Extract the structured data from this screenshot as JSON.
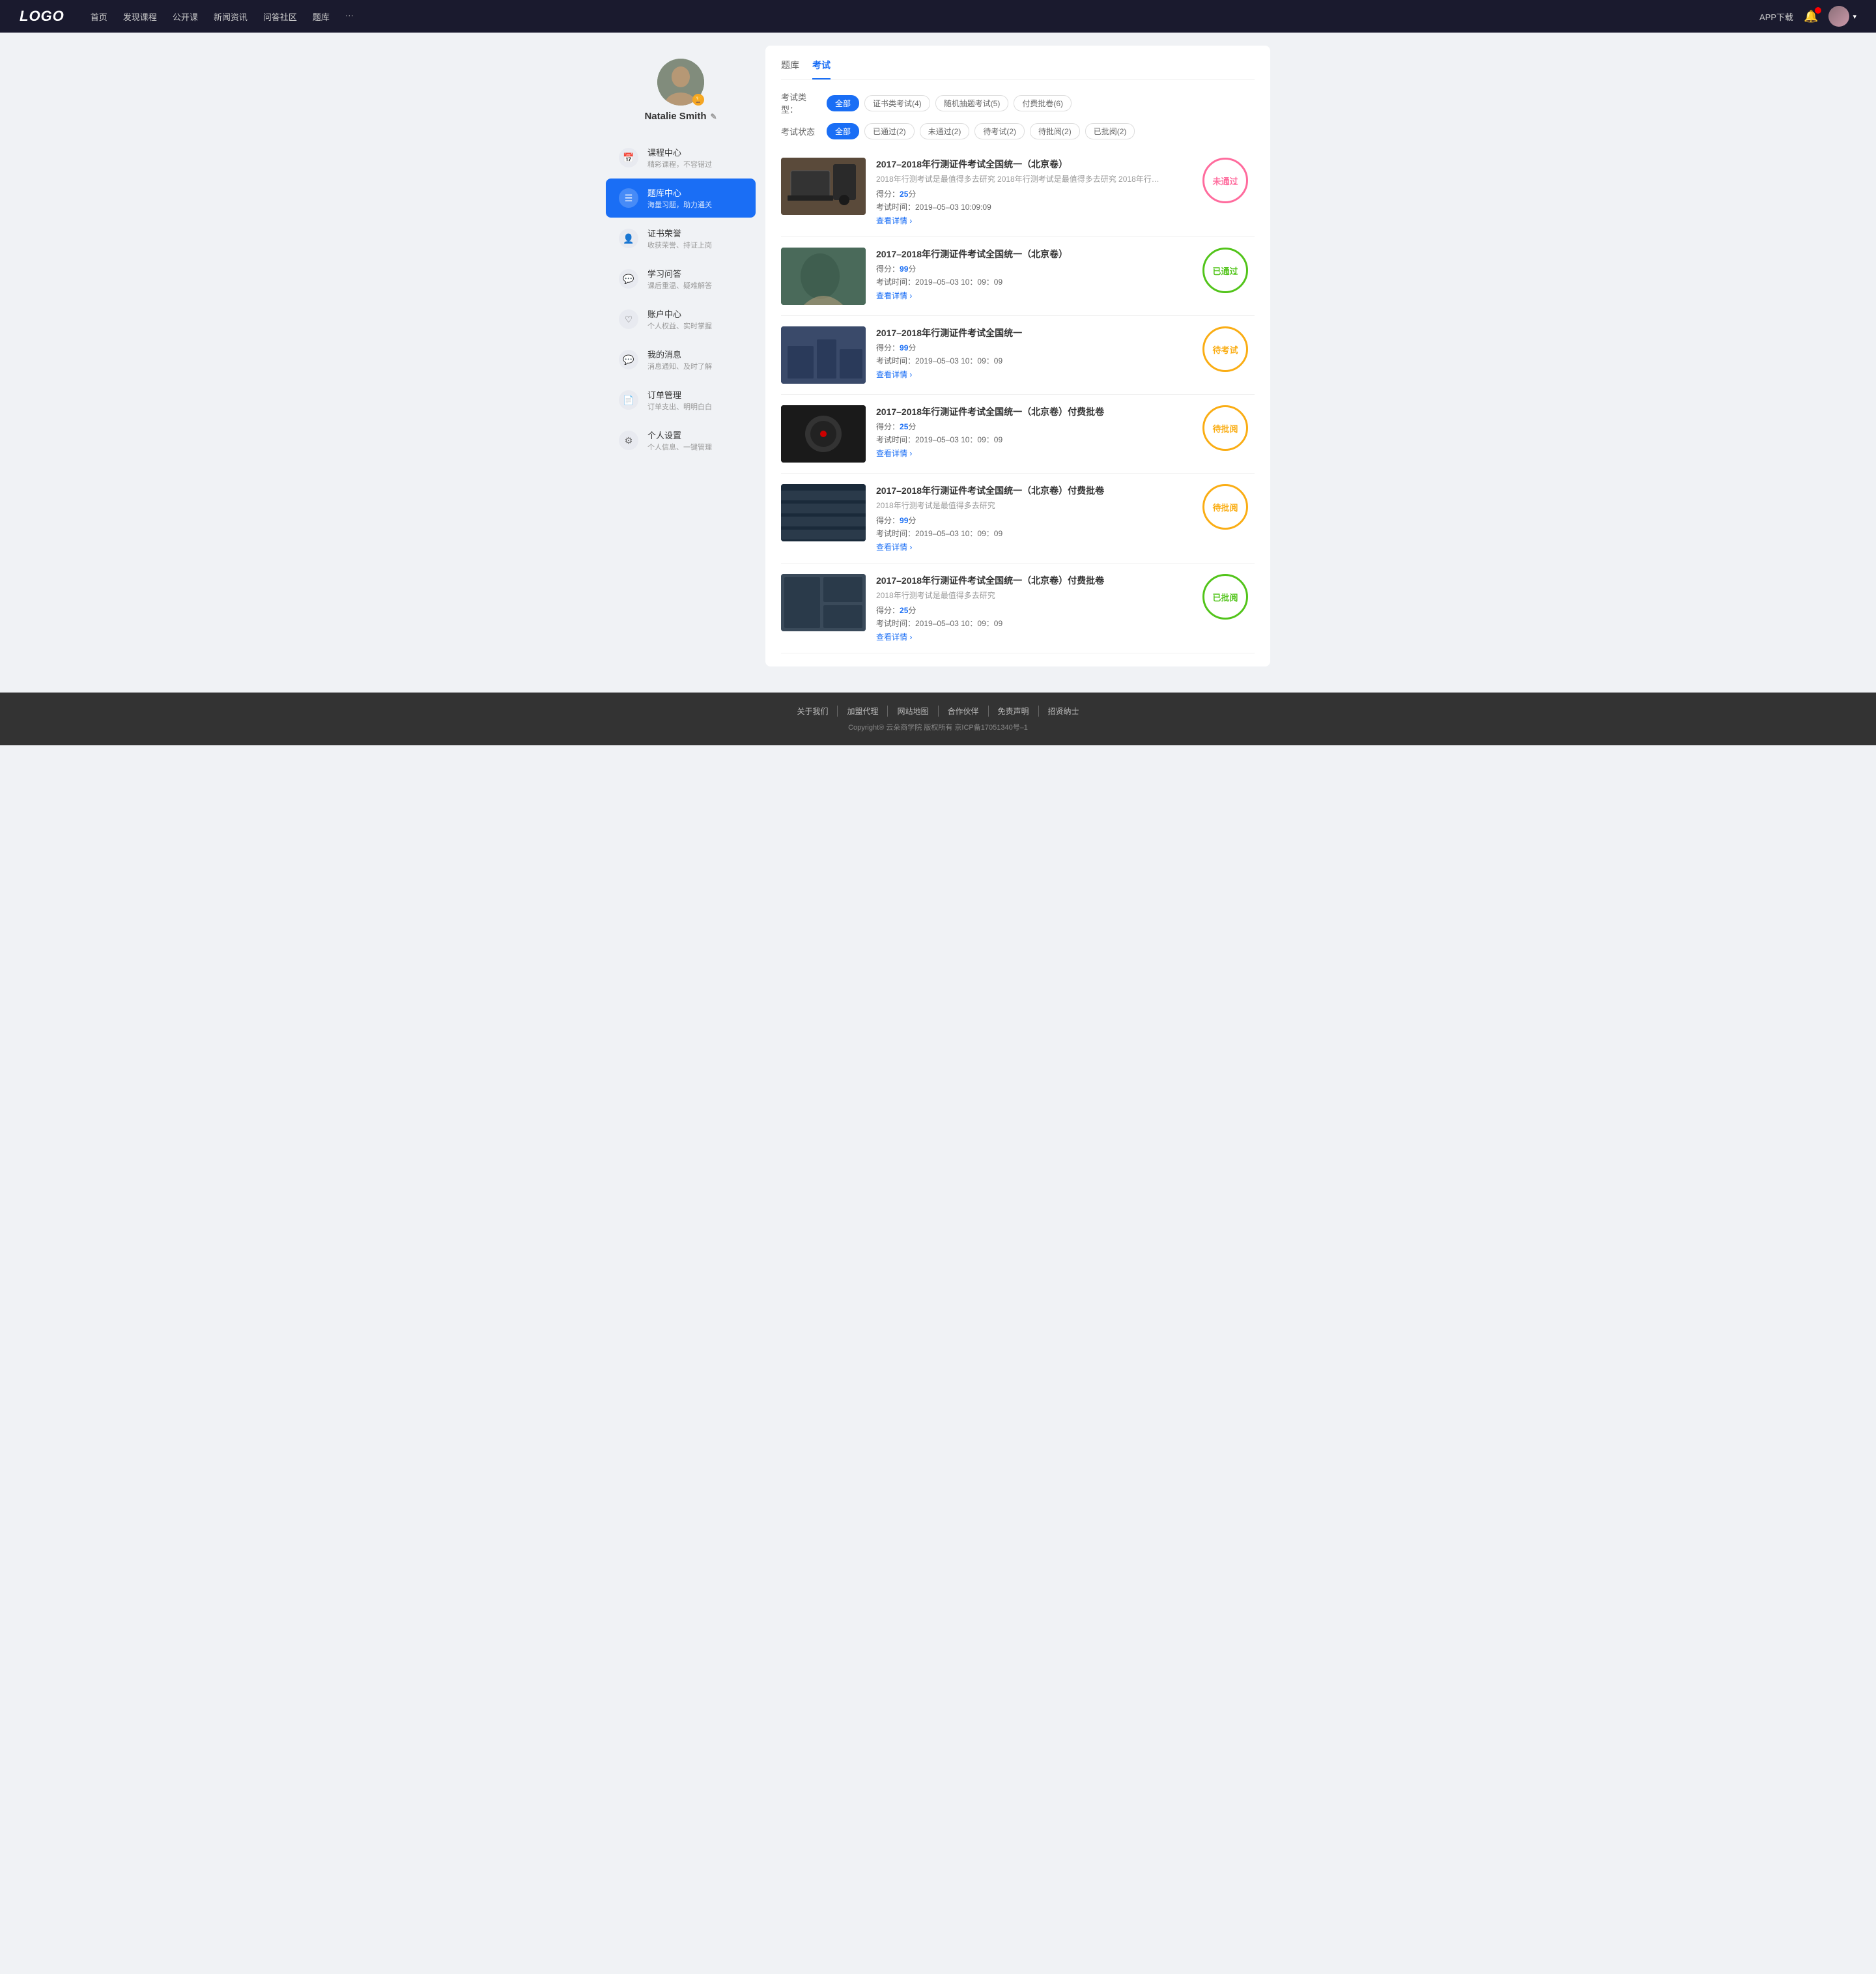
{
  "navbar": {
    "logo": "LOGO",
    "navItems": [
      "首页",
      "发现课程",
      "公开课",
      "新闻资讯",
      "问答社区",
      "题库",
      "···"
    ],
    "appDownload": "APP下载"
  },
  "sidebar": {
    "profile": {
      "name": "Natalie Smith",
      "editIcon": "✎"
    },
    "menuItems": [
      {
        "id": "course-center",
        "icon": "📅",
        "title": "课程中心",
        "sub": "精彩课程，不容错过"
      },
      {
        "id": "question-bank",
        "icon": "☰",
        "title": "题库中心",
        "sub": "海量习题，助力通关",
        "active": true
      },
      {
        "id": "certificate",
        "icon": "👤",
        "title": "证书荣誉",
        "sub": "收获荣誉、持证上岗"
      },
      {
        "id": "qa",
        "icon": "💬",
        "title": "学习问答",
        "sub": "课后重温、疑难解答"
      },
      {
        "id": "account",
        "icon": "♡",
        "title": "账户中心",
        "sub": "个人权益、实时掌握"
      },
      {
        "id": "messages",
        "icon": "💬",
        "title": "我的消息",
        "sub": "消息通知、及时了解"
      },
      {
        "id": "orders",
        "icon": "📄",
        "title": "订单管理",
        "sub": "订单支出、明明白白"
      },
      {
        "id": "settings",
        "icon": "⚙",
        "title": "个人设置",
        "sub": "个人信息、一键管理"
      }
    ]
  },
  "main": {
    "topTabs": [
      {
        "id": "question-bank",
        "label": "题库"
      },
      {
        "id": "exam",
        "label": "考试",
        "active": true
      }
    ],
    "filterTypeLabel": "考试类型：",
    "filterTypes": [
      {
        "label": "全部",
        "active": true
      },
      {
        "label": "证书类考试(4)"
      },
      {
        "label": "随机抽题考试(5)"
      },
      {
        "label": "付费批卷(6)"
      }
    ],
    "filterStatusLabel": "考试状态",
    "filterStatuses": [
      {
        "label": "全部",
        "active": true
      },
      {
        "label": "已通过(2)"
      },
      {
        "label": "未通过(2)"
      },
      {
        "label": "待考试(2)"
      },
      {
        "label": "待批阅(2)"
      },
      {
        "label": "已批阅(2)"
      }
    ],
    "examItems": [
      {
        "id": 1,
        "title": "2017–2018年行测证件考试全国统一（北京卷）",
        "desc": "2018年行测考试是最值得多去研究 2018年行测考试是最值得多去研究 2018年行…",
        "score": "25",
        "scoreUnit": "分",
        "examTime": "考试时间：2019–05–03  10:09:09",
        "detailLink": "查看详情",
        "status": "未通过",
        "statusType": "not-passed",
        "thumbClass": "thumb-1"
      },
      {
        "id": 2,
        "title": "2017–2018年行测证件考试全国统一（北京卷）",
        "desc": "",
        "score": "99",
        "scoreUnit": "分",
        "examTime": "考试时间：2019–05–03  10：09：09",
        "detailLink": "查看详情",
        "status": "已通过",
        "statusType": "passed",
        "thumbClass": "thumb-2"
      },
      {
        "id": 3,
        "title": "2017–2018年行测证件考试全国统一",
        "desc": "",
        "score": "99",
        "scoreUnit": "分",
        "examTime": "考试时间：2019–05–03  10：09：09",
        "detailLink": "查看详情",
        "status": "待考试",
        "statusType": "pending",
        "thumbClass": "thumb-3"
      },
      {
        "id": 4,
        "title": "2017–2018年行测证件考试全国统一（北京卷）付费批卷",
        "desc": "",
        "score": "25",
        "scoreUnit": "分",
        "examTime": "考试时间：2019–05–03  10：09：09",
        "detailLink": "查看详情",
        "status": "待批阅",
        "statusType": "pending-review",
        "thumbClass": "thumb-4"
      },
      {
        "id": 5,
        "title": "2017–2018年行测证件考试全国统一（北京卷）付费批卷",
        "desc": "2018年行测考试是最值得多去研究",
        "score": "99",
        "scoreUnit": "分",
        "examTime": "考试时间：2019–05–03  10：09：09",
        "detailLink": "查看详情",
        "status": "待批阅",
        "statusType": "pending-review",
        "thumbClass": "thumb-5"
      },
      {
        "id": 6,
        "title": "2017–2018年行测证件考试全国统一（北京卷）付费批卷",
        "desc": "2018年行测考试是最值得多去研究",
        "score": "25",
        "scoreUnit": "分",
        "examTime": "考试时间：2019–05–03  10：09：09",
        "detailLink": "查看详情",
        "status": "已批阅",
        "statusType": "reviewed",
        "thumbClass": "thumb-6"
      }
    ]
  },
  "footer": {
    "links": [
      "关于我们",
      "加盟代理",
      "网站地图",
      "合作伙伴",
      "免责声明",
      "招贤纳士"
    ],
    "copyright": "Copyright® 云朵商学院  版权所有    京ICP备17051340号–1"
  }
}
